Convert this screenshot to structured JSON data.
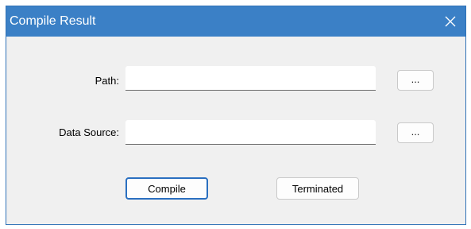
{
  "window": {
    "title": "Compile Result"
  },
  "form": {
    "path_label": "Path:",
    "path_value": "",
    "path_browse_label": "...",
    "data_source_label": "Data Source:",
    "data_source_value": "",
    "data_source_browse_label": "..."
  },
  "actions": {
    "compile_label": "Compile",
    "terminated_label": "Terminated"
  },
  "colors": {
    "titlebar": "#3b80c6",
    "window_background": "#f0f0f0",
    "default_button_border": "#2a6fc0"
  },
  "icons": {
    "close": "close-icon"
  }
}
